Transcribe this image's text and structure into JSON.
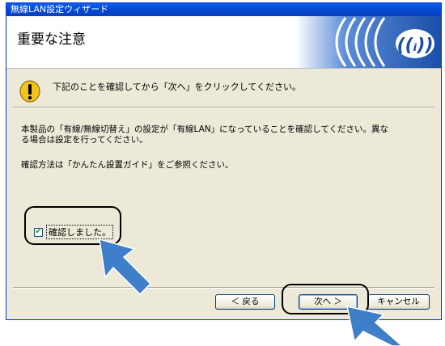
{
  "window": {
    "title": "無線LAN設定ウィザード"
  },
  "header": {
    "title": "重要な注意"
  },
  "notice": {
    "text": "下記のことを確認してから「次へ」をクリックしてください。"
  },
  "body": {
    "line1": "本製品の「有線/無線切替え」の設定が「有線LAN」になっていることを確認してください。異な",
    "line2": "る場合は設定を行ってください。",
    "reference": "確認方法は「かんたん設置ガイド」をご参照ください。"
  },
  "checkbox": {
    "label": "確認しました。",
    "checked": true
  },
  "buttons": {
    "back": "＜ 戻る",
    "next": "次へ ＞",
    "cancel": "キャンセル"
  },
  "colors": {
    "titlebar": "#0a5fe8",
    "logo_blue": "#1b4fa8",
    "face": "#ece9d8",
    "arrow": "#3f7fc9"
  },
  "icons": {
    "notice": "warning-icon",
    "logo": "wireless-logo-icon"
  }
}
